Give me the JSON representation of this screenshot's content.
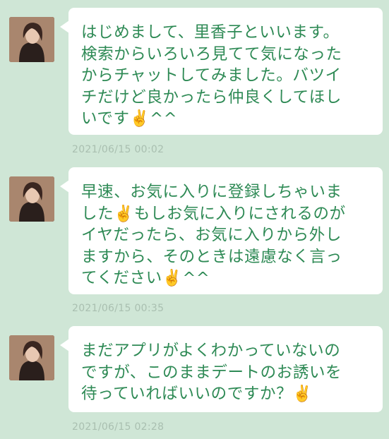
{
  "messages": [
    {
      "text": "はじめまして、里香子といいます。\n検索からいろいろ見てて気になった\nからチャットしてみました。バツイ\nチだけど良かったら仲良くしてほし\nいです✌️^^",
      "timestamp": "2021/06/15 00:02"
    },
    {
      "text": "早速、お気に入りに登録しちゃいま\nした✌️もしお気に入りにされるのが\nイヤだったら、お気に入りから外し\nますから、そのときは遠慮なく言っ\nてください✌️^^",
      "timestamp": "2021/06/15 00:35"
    },
    {
      "text": "まだアプリがよくわかっていないの\nですが、このままデートのお誘いを\n待っていればいいのですか？✌️",
      "timestamp": "2021/06/15 02:28"
    }
  ],
  "colors": {
    "background": "#cfe6d6",
    "bubble": "#ffffff",
    "message_text": "#2e8a55",
    "timestamp_text": "#a9bfb0"
  },
  "icons": {
    "avatar": "user-avatar-photo"
  }
}
